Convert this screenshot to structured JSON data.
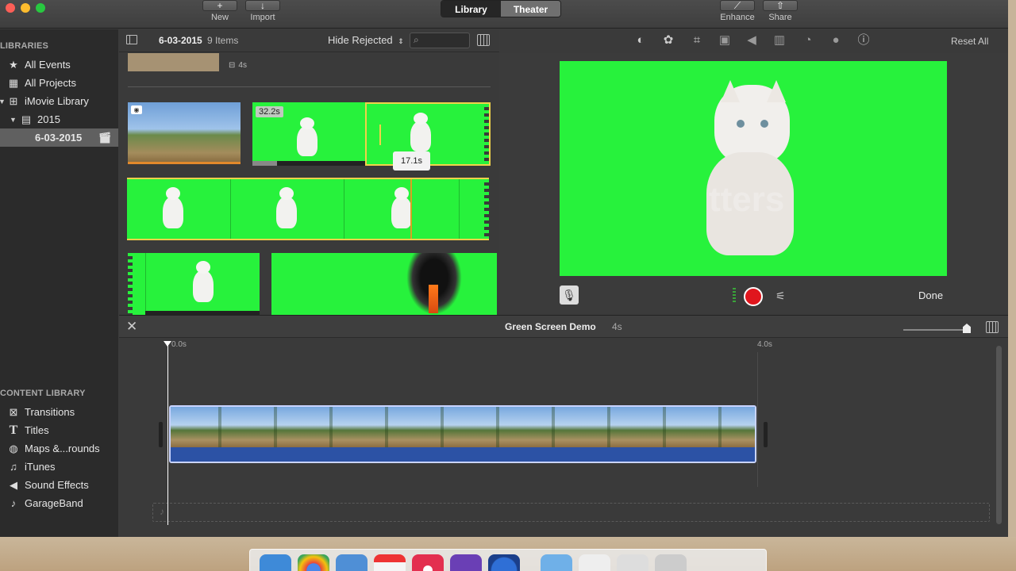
{
  "toolbar": {
    "new_label": "New",
    "import_label": "Import",
    "library_tab": "Library",
    "theater_tab": "Theater",
    "enhance_label": "Enhance",
    "share_label": "Share"
  },
  "sidebar": {
    "libraries_heading": "LIBRARIES",
    "items": [
      {
        "label": "All Events",
        "icon": "star-icon"
      },
      {
        "label": "All Projects",
        "icon": "grid-icon"
      },
      {
        "label": "iMovie Library",
        "icon": "library-icon"
      },
      {
        "label": "2015",
        "icon": "calendar-icon"
      },
      {
        "label": "6-03-2015",
        "icon": "clapper-icon"
      }
    ],
    "content_heading": "CONTENT LIBRARY",
    "content_items": [
      {
        "label": "Transitions",
        "icon": "transitions-icon"
      },
      {
        "label": "Titles",
        "icon": "titles-icon"
      },
      {
        "label": "Maps &...rounds",
        "icon": "globe-icon"
      },
      {
        "label": "iTunes",
        "icon": "music-note-icon"
      },
      {
        "label": "Sound Effects",
        "icon": "speaker-icon"
      },
      {
        "label": "GarageBand",
        "icon": "guitar-icon"
      }
    ]
  },
  "browser": {
    "event_title": "6-03-2015",
    "item_count": "9 Items",
    "filter_label": "Hide Rejected",
    "top_clip_duration": "4s",
    "clip2_duration": "32.2s",
    "skim_tooltip": "17.1s"
  },
  "viewer": {
    "reset_all_label": "Reset All",
    "done_label": "Done",
    "watermark": "tters"
  },
  "timeline": {
    "project_title": "Green Screen Demo",
    "project_duration": "4s",
    "ruler_start": "0.0s",
    "ruler_end": "4.0s"
  },
  "colors": {
    "green_screen": "#27f23c",
    "selection_yellow": "#f1d24a",
    "record_red": "#e0161d",
    "audio_blue": "#2c52a5"
  }
}
